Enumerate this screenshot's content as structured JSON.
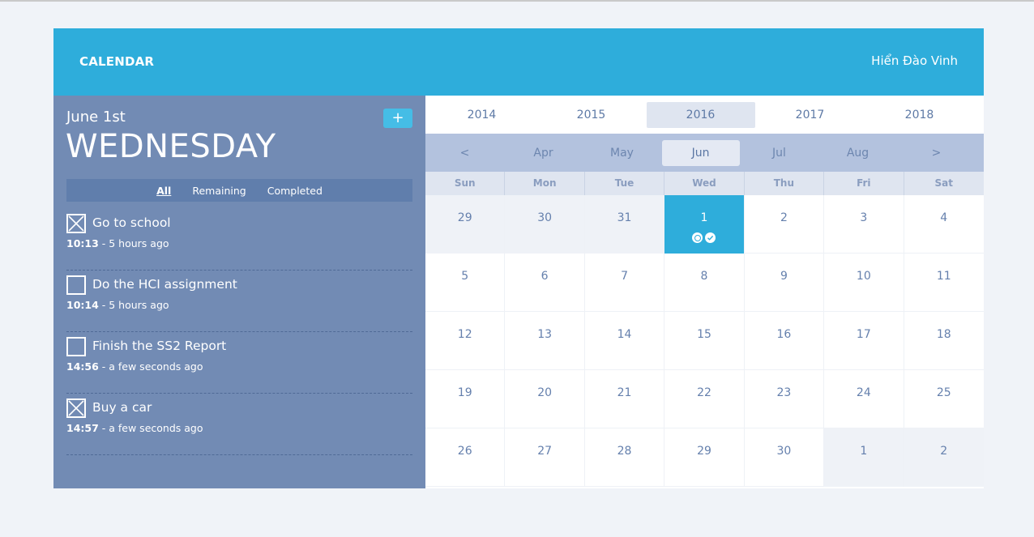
{
  "header": {
    "title": "CALENDAR",
    "user": "Hiển Đào Vinh"
  },
  "left": {
    "date": "June 1st",
    "day": "WEDNESDAY",
    "add_label": "+",
    "filters": [
      "All",
      "Remaining",
      "Completed"
    ],
    "active_filter": "All",
    "tasks": [
      {
        "title": "Go to school",
        "time": "10:13",
        "ago": " - 5 hours ago",
        "checked": true
      },
      {
        "title": "Do the HCI assignment",
        "time": "10:14",
        "ago": " - 5 hours ago",
        "checked": false
      },
      {
        "title": "Finish the SS2 Report",
        "time": "14:56",
        "ago": " - a few seconds ago",
        "checked": false
      },
      {
        "title": "Buy a car",
        "time": "14:57",
        "ago": " - a few seconds ago",
        "checked": true
      }
    ]
  },
  "calendar": {
    "years": [
      "2014",
      "2015",
      "2016",
      "2017",
      "2018"
    ],
    "selected_year": "2016",
    "months": [
      "<",
      "Apr",
      "May",
      "Jun",
      "Jul",
      "Aug",
      ">"
    ],
    "selected_month": "Jun",
    "weekdays": [
      "Sun",
      "Mon",
      "Tue",
      "Wed",
      "Thu",
      "Fri",
      "Sat"
    ],
    "weeks": [
      [
        "29",
        "30",
        "31",
        "1",
        "2",
        "3",
        "4"
      ],
      [
        "5",
        "6",
        "7",
        "8",
        "9",
        "10",
        "11"
      ],
      [
        "12",
        "13",
        "14",
        "15",
        "16",
        "17",
        "18"
      ],
      [
        "19",
        "20",
        "21",
        "22",
        "23",
        "24",
        "25"
      ],
      [
        "26",
        "27",
        "28",
        "29",
        "30",
        "1",
        "2"
      ]
    ],
    "colors": {
      "accent": "#2eaddb",
      "sidebar": "#728bb4",
      "month_bar": "#b3c2de"
    }
  }
}
